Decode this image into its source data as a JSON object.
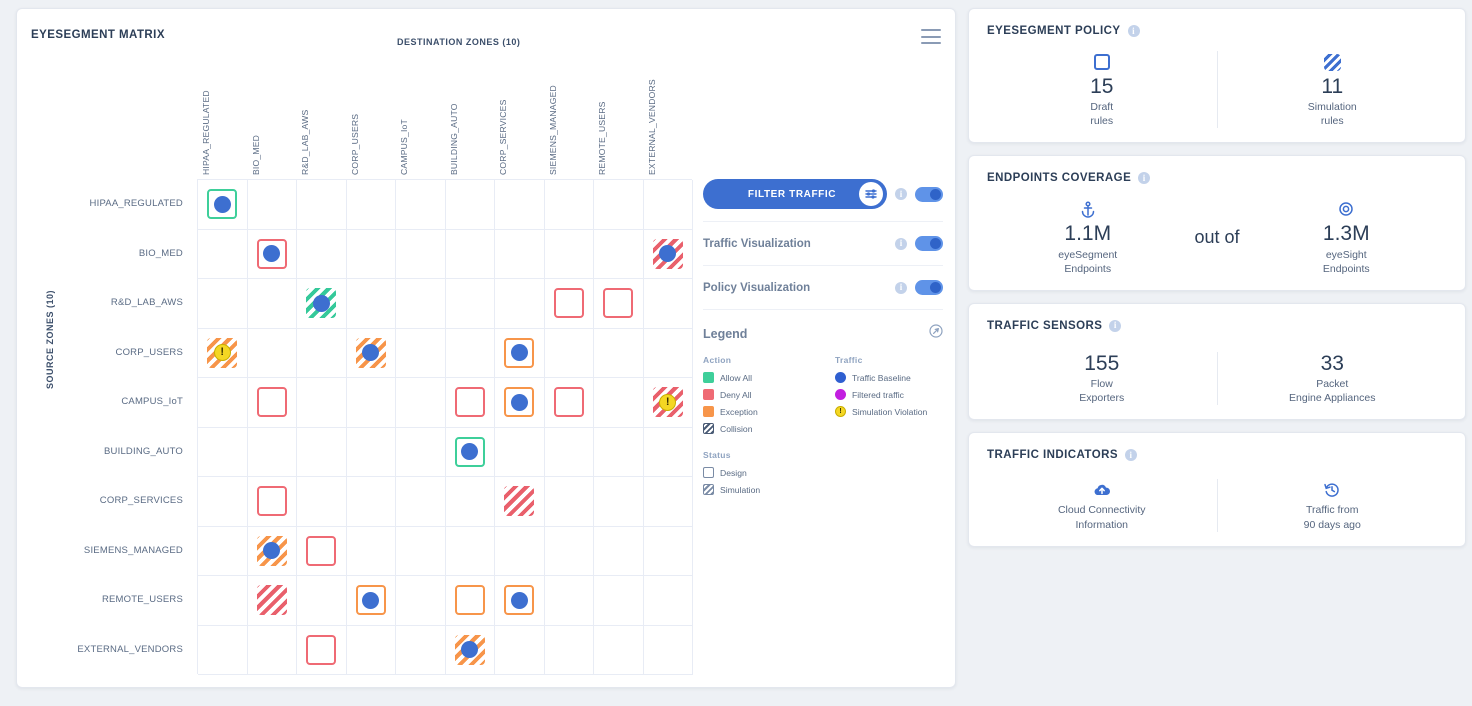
{
  "matrix": {
    "title": "EYESEGMENT MATRIX",
    "menu_icon": "hamburger-menu-icon",
    "dest_axis_label": "DESTINATION ZONES  (10)",
    "source_axis_label": "SOURCE ZONES  (10)",
    "zones": [
      "HIPAA_REGULATED",
      "BIO_MED",
      "R&D_LAB_AWS",
      "CORP_USERS",
      "CAMPUS_IoT",
      "BUILDING_AUTO",
      "CORP_SERVICES",
      "SIEMENS_MANAGED",
      "REMOTE_USERS",
      "EXTERNAL_VENDORS"
    ],
    "cells": [
      {
        "row": 0,
        "col": 0,
        "action": "allow",
        "style": "border",
        "traffic": "baseline"
      },
      {
        "row": 1,
        "col": 1,
        "action": "deny",
        "style": "border",
        "traffic": "baseline"
      },
      {
        "row": 1,
        "col": 9,
        "action": "deny",
        "style": "hatched",
        "traffic": "baseline"
      },
      {
        "row": 2,
        "col": 2,
        "action": "allow",
        "style": "hatched",
        "traffic": "baseline"
      },
      {
        "row": 2,
        "col": 7,
        "action": "deny",
        "style": "border",
        "traffic": "none"
      },
      {
        "row": 2,
        "col": 8,
        "action": "deny",
        "style": "border",
        "traffic": "none"
      },
      {
        "row": 3,
        "col": 0,
        "action": "exception",
        "style": "hatched",
        "traffic": "violation"
      },
      {
        "row": 3,
        "col": 3,
        "action": "exception",
        "style": "hatched",
        "traffic": "baseline"
      },
      {
        "row": 3,
        "col": 6,
        "action": "exception",
        "style": "border",
        "traffic": "baseline"
      },
      {
        "row": 4,
        "col": 1,
        "action": "deny",
        "style": "border",
        "traffic": "none"
      },
      {
        "row": 4,
        "col": 5,
        "action": "deny",
        "style": "border",
        "traffic": "none"
      },
      {
        "row": 4,
        "col": 6,
        "action": "exception",
        "style": "border",
        "traffic": "baseline"
      },
      {
        "row": 4,
        "col": 7,
        "action": "deny",
        "style": "border",
        "traffic": "none"
      },
      {
        "row": 4,
        "col": 9,
        "action": "deny",
        "style": "hatched",
        "traffic": "violation"
      },
      {
        "row": 5,
        "col": 5,
        "action": "allow",
        "style": "border",
        "traffic": "baseline"
      },
      {
        "row": 6,
        "col": 1,
        "action": "deny",
        "style": "border",
        "traffic": "none"
      },
      {
        "row": 6,
        "col": 6,
        "action": "deny",
        "style": "hatched",
        "traffic": "none"
      },
      {
        "row": 7,
        "col": 1,
        "action": "exception",
        "style": "hatched",
        "traffic": "baseline"
      },
      {
        "row": 7,
        "col": 2,
        "action": "deny",
        "style": "border",
        "traffic": "none"
      },
      {
        "row": 8,
        "col": 1,
        "action": "deny",
        "style": "hatched",
        "traffic": "none"
      },
      {
        "row": 8,
        "col": 3,
        "action": "exception",
        "style": "border",
        "traffic": "baseline"
      },
      {
        "row": 8,
        "col": 5,
        "action": "exception",
        "style": "border",
        "traffic": "none"
      },
      {
        "row": 8,
        "col": 6,
        "action": "exception",
        "style": "border",
        "traffic": "baseline"
      },
      {
        "row": 9,
        "col": 2,
        "action": "deny",
        "style": "border",
        "traffic": "none"
      },
      {
        "row": 9,
        "col": 5,
        "action": "exception",
        "style": "hatched",
        "traffic": "baseline"
      }
    ]
  },
  "controls": {
    "filter_button": "FILTER TRAFFIC",
    "filter_icon": "filter-sliders-icon",
    "rows": [
      {
        "label": "Traffic Visualization",
        "enabled": true
      },
      {
        "label": "Policy Visualization",
        "enabled": true
      }
    ]
  },
  "legend": {
    "title": "Legend",
    "expand_icon": "expand-legend-icon",
    "groups": [
      {
        "name": "Action",
        "items": [
          {
            "label": "Allow All",
            "swatch": "allow"
          },
          {
            "label": "Deny All",
            "swatch": "deny"
          },
          {
            "label": "Exception",
            "swatch": "exc"
          },
          {
            "label": "Collision",
            "swatch": "coll"
          }
        ]
      },
      {
        "name": "Traffic",
        "items": [
          {
            "label": "Traffic Baseline",
            "swatch": "dot-b"
          },
          {
            "label": "Filtered traffic",
            "swatch": "dot-f"
          },
          {
            "label": "Simulation Violation",
            "swatch": "dot-w"
          }
        ]
      },
      {
        "name": "Status",
        "items": [
          {
            "label": "Design",
            "swatch": "design"
          },
          {
            "label": "Simulation",
            "swatch": "sim"
          }
        ]
      }
    ]
  },
  "panels": [
    {
      "title": "EYESEGMENT POLICY",
      "layout": "two-stats",
      "stats": [
        {
          "icon": "draft-rule-square-icon",
          "value": "15",
          "caption": "Draft\nrules"
        },
        {
          "icon": "simulation-rule-hatch-icon",
          "value": "11",
          "caption": "Simulation\nrules"
        }
      ]
    },
    {
      "title": "ENDPOINTS COVERAGE",
      "layout": "out-of",
      "connector": "out of",
      "stats": [
        {
          "icon": "anchor-icon",
          "value": "1.1M",
          "caption": "eyeSegment\nEndpoints"
        },
        {
          "icon": "target-icon",
          "value": "1.3M",
          "caption": "eyeSight\nEndpoints"
        }
      ]
    },
    {
      "title": "TRAFFIC SENSORS",
      "layout": "two-stats",
      "stats": [
        {
          "icon": "",
          "value": "155",
          "caption": "Flow\nExporters"
        },
        {
          "icon": "",
          "value": "33",
          "caption": "Packet\nEngine Appliances"
        }
      ]
    },
    {
      "title": "TRAFFIC INDICATORS",
      "layout": "two-stats",
      "stats": [
        {
          "icon": "cloud-upload-icon",
          "value": "",
          "caption": "Cloud Connectivity\nInformation"
        },
        {
          "icon": "history-clock-icon",
          "value": "",
          "caption": "Traffic from\n90 days ago"
        }
      ]
    }
  ],
  "colors": {
    "allow": "#3ecf9a",
    "deny": "#ef6a74",
    "exception": "#f7954a",
    "traffic_baseline": "#3d6fd0",
    "filtered_traffic": "#c21fe0",
    "violation": "#f4d723",
    "accent": "#3d6fd0"
  }
}
